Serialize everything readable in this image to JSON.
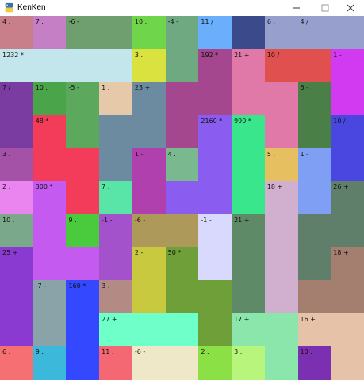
{
  "window": {
    "title": "KenKen",
    "minimize_icon": "minimize-icon",
    "maximize_icon": "maximize-icon",
    "close_icon": "close-icon",
    "app_icon": "python-icon"
  },
  "board": {
    "size": 11,
    "cells": [
      [
        "#c87f8a",
        "#c57fc5",
        "#6f9f6f",
        "#6f9f6f",
        "#6fd54a",
        "#6fa981",
        "#6baefc",
        "#3a4a8a",
        "#979fcc",
        "#979fcc",
        "#979fcc"
      ],
      [
        "#c2e6ec",
        "#c2e6ec",
        "#c2e6ec",
        "#c2e6ec",
        "#d9e23e",
        "#6fa981",
        "#a4478f",
        "#e079a8",
        "#e0504f",
        "#e0504f",
        "#d13af0"
      ],
      [
        "#7a3ca0",
        "#4aa44a",
        "#5ca85c",
        "#e6c9a8",
        "#6c8ba0",
        "#a4478f",
        "#a4478f",
        "#e079a8",
        "#e079a8",
        "#4a7f47",
        "#d13af0"
      ],
      [
        "#7a3ca0",
        "#f23c5a",
        "#5ca85c",
        "#6c8ba0",
        "#6c8ba0",
        "#a4478f",
        "#8a5cf0",
        "#3ae68c",
        "#e079a8",
        "#4a7f47",
        "#4a47e0"
      ],
      [
        "#a451a8",
        "#f23c5a",
        "#f23c5a",
        "#6c8ba0",
        "#b040ad",
        "#7ab88f",
        "#8a5cf0",
        "#3ae68c",
        "#e6c060",
        "#7f9ff4",
        "#4a47e0"
      ],
      [
        "#ea85ef",
        "#c55af0",
        "#f23c5a",
        "#5ae5a8",
        "#b040ad",
        "#8a5cf0",
        "#8a5cf0",
        "#3ae68c",
        "#d1b0cf",
        "#7f9ff4",
        "#5f7f6a"
      ],
      [
        "#7aa88a",
        "#c55af0",
        "#4acb3e",
        "#a451cc",
        "#ad9a5a",
        "#ad9a5a",
        "#d8d9fc",
        "#5f8a67",
        "#d1b0cf",
        "#5f7f6a",
        "#5f7f6a"
      ],
      [
        "#8a3ad0",
        "#c55af0",
        "#c55af0",
        "#a451cc",
        "#c9c93f",
        "#6f9f39",
        "#d8d9fc",
        "#5f8a67",
        "#d1b0cf",
        "#5f7f6a",
        "#a47f6f"
      ],
      [
        "#8a3ad0",
        "#8aa3a8",
        "#3348ff",
        "#b38a84",
        "#c9c93f",
        "#6f9f39",
        "#6f9f39",
        "#5f8a67",
        "#d1b0cf",
        "#a47f6f",
        "#a47f6f"
      ],
      [
        "#8a3ad0",
        "#8aa3a8",
        "#3348ff",
        "#6fffc9",
        "#6fffc9",
        "#6fffc9",
        "#6f9f39",
        "#8ae6ab",
        "#8ae6ab",
        "#e6c2a8",
        "#e6c2a8"
      ],
      [
        "#f56f73",
        "#3bb8da",
        "#3348ff",
        "#f36873",
        "#efe8c8",
        "#efe8c8",
        "#8ae045",
        "#b8f57c",
        "#8ae6ab",
        "#7a30b0",
        "#e6c2a8"
      ]
    ],
    "clues": [
      {
        "r": 0,
        "c": 0,
        "text": "4 ."
      },
      {
        "r": 0,
        "c": 1,
        "text": "7 ."
      },
      {
        "r": 0,
        "c": 2,
        "text": "-6 -"
      },
      {
        "r": 0,
        "c": 4,
        "text": "10 ."
      },
      {
        "r": 0,
        "c": 5,
        "text": "-4 -"
      },
      {
        "r": 0,
        "c": 6,
        "text": "11 /"
      },
      {
        "r": 0,
        "c": 8,
        "text": "6 ."
      },
      {
        "r": 0,
        "c": 9,
        "text": "4 /"
      },
      {
        "r": 1,
        "c": 0,
        "text": "1232 *"
      },
      {
        "r": 1,
        "c": 4,
        "text": "3 ."
      },
      {
        "r": 1,
        "c": 6,
        "text": "192 *"
      },
      {
        "r": 1,
        "c": 7,
        "text": "21 +"
      },
      {
        "r": 1,
        "c": 8,
        "text": "10 /"
      },
      {
        "r": 1,
        "c": 10,
        "text": "1 -"
      },
      {
        "r": 2,
        "c": 0,
        "text": "7 /"
      },
      {
        "r": 2,
        "c": 1,
        "text": "10 ."
      },
      {
        "r": 2,
        "c": 2,
        "text": "-5 -"
      },
      {
        "r": 2,
        "c": 3,
        "text": "1 ."
      },
      {
        "r": 2,
        "c": 4,
        "text": "23 +"
      },
      {
        "r": 2,
        "c": 9,
        "text": "6 -"
      },
      {
        "r": 3,
        "c": 1,
        "text": "48 *"
      },
      {
        "r": 3,
        "c": 6,
        "text": "2160 *"
      },
      {
        "r": 3,
        "c": 7,
        "text": "990 *"
      },
      {
        "r": 3,
        "c": 10,
        "text": "10 /"
      },
      {
        "r": 4,
        "c": 0,
        "text": "3 ."
      },
      {
        "r": 4,
        "c": 4,
        "text": "1 -"
      },
      {
        "r": 4,
        "c": 5,
        "text": "4 ."
      },
      {
        "r": 4,
        "c": 8,
        "text": "5 ."
      },
      {
        "r": 4,
        "c": 9,
        "text": "1 -"
      },
      {
        "r": 5,
        "c": 0,
        "text": "2 ."
      },
      {
        "r": 5,
        "c": 1,
        "text": "300 *"
      },
      {
        "r": 5,
        "c": 3,
        "text": "7 ."
      },
      {
        "r": 5,
        "c": 8,
        "text": "18 +"
      },
      {
        "r": 5,
        "c": 10,
        "text": "26 +"
      },
      {
        "r": 6,
        "c": 0,
        "text": "10 ."
      },
      {
        "r": 6,
        "c": 2,
        "text": "9 ."
      },
      {
        "r": 6,
        "c": 3,
        "text": "-1 -"
      },
      {
        "r": 6,
        "c": 4,
        "text": "-6 -"
      },
      {
        "r": 6,
        "c": 6,
        "text": "-1 -"
      },
      {
        "r": 6,
        "c": 7,
        "text": "21 +"
      },
      {
        "r": 7,
        "c": 0,
        "text": "25 +"
      },
      {
        "r": 7,
        "c": 4,
        "text": "2 -"
      },
      {
        "r": 7,
        "c": 5,
        "text": "50 *"
      },
      {
        "r": 7,
        "c": 10,
        "text": "18 +"
      },
      {
        "r": 8,
        "c": 1,
        "text": "-7 -"
      },
      {
        "r": 8,
        "c": 2,
        "text": "160 *"
      },
      {
        "r": 8,
        "c": 3,
        "text": "3 ."
      },
      {
        "r": 9,
        "c": 3,
        "text": "27 +"
      },
      {
        "r": 9,
        "c": 7,
        "text": "17 +"
      },
      {
        "r": 9,
        "c": 9,
        "text": "16 +"
      },
      {
        "r": 10,
        "c": 0,
        "text": "6 ."
      },
      {
        "r": 10,
        "c": 1,
        "text": "9 ."
      },
      {
        "r": 10,
        "c": 3,
        "text": "11 ."
      },
      {
        "r": 10,
        "c": 4,
        "text": "-6 -"
      },
      {
        "r": 10,
        "c": 6,
        "text": "2 ."
      },
      {
        "r": 10,
        "c": 7,
        "text": "3 ."
      },
      {
        "r": 10,
        "c": 9,
        "text": "10 ."
      }
    ]
  }
}
